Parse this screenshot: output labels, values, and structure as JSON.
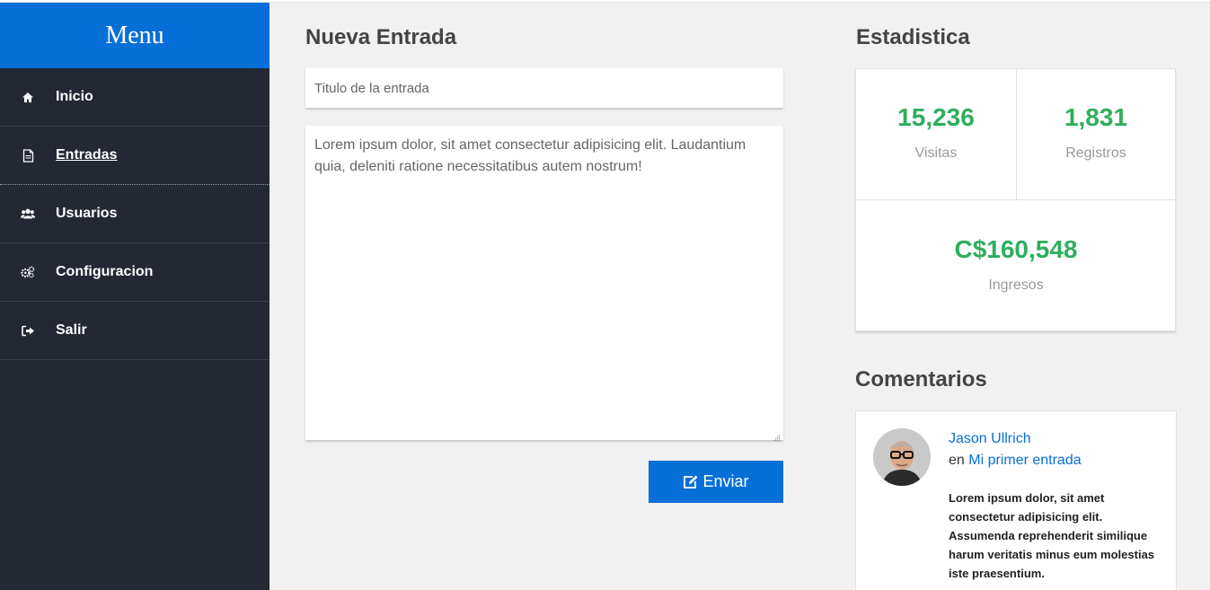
{
  "sidebar": {
    "header": "Menu",
    "items": [
      {
        "label": "Inicio",
        "icon": "home-icon",
        "active": false
      },
      {
        "label": "Entradas",
        "icon": "document-icon",
        "active": true
      },
      {
        "label": "Usuarios",
        "icon": "users-icon",
        "active": false
      },
      {
        "label": "Configuracion",
        "icon": "gears-icon",
        "active": false
      },
      {
        "label": "Salir",
        "icon": "sign-out-icon",
        "active": false
      }
    ]
  },
  "editor": {
    "title": "Nueva Entrada",
    "title_placeholder": "Titulo de la entrada",
    "body_value": "Lorem ipsum dolor, sit amet consectetur adipisicing elit. Laudantium quia, deleniti ratione necessitatibus autem nostrum!",
    "submit_label": "Enviar"
  },
  "stats": {
    "title": "Estadistica",
    "visits": {
      "value": "15,236",
      "label": "Visitas"
    },
    "registrations": {
      "value": "1,831",
      "label": "Registros"
    },
    "income": {
      "value": "C$160,548",
      "label": "Ingresos"
    }
  },
  "comments": {
    "title": "Comentarios",
    "items": [
      {
        "author": "Jason Ullrich",
        "prefix": "en",
        "post": "Mi primer entrada",
        "text": "Lorem ipsum dolor, sit amet consectetur adipisicing elit. Assumenda reprehenderit similique harum veritatis minus eum molestias iste praesentium."
      }
    ]
  },
  "colors": {
    "brand_blue": "#0770d8",
    "sidebar_bg": "#232833",
    "stat_green": "#2fae5d",
    "page_bg": "#f1f1f1"
  }
}
